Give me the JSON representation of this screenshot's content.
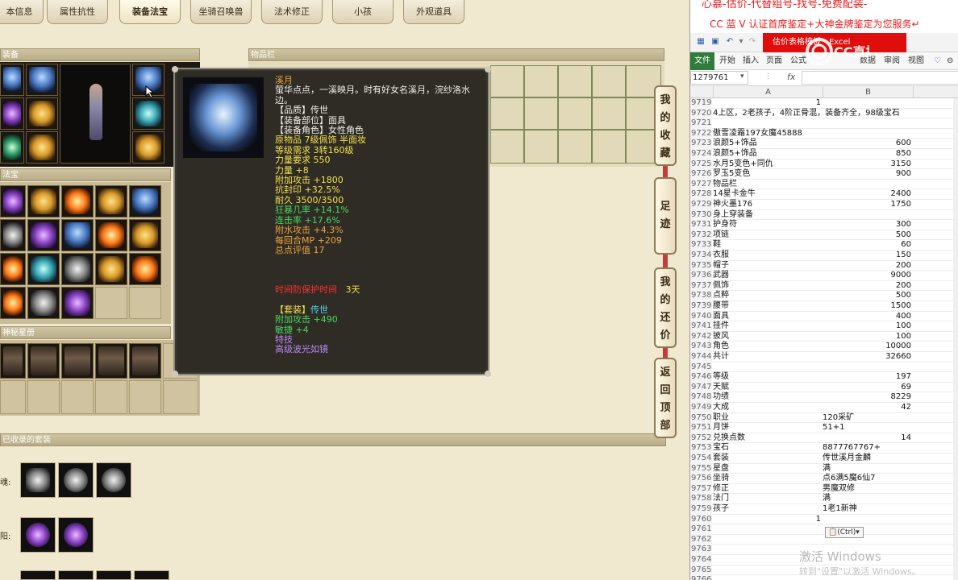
{
  "tabs": [
    "本信息",
    "属性抗性",
    "装备法宝",
    "坐骑召唤兽",
    "法术修正",
    "小孩",
    "外观道具"
  ],
  "active_tab": 2,
  "sections": {
    "equip": "装备",
    "inventory": "物品栏",
    "treasure": "法宝",
    "cards": "神秘星册",
    "suits": "已收录的套装"
  },
  "suit_labels": [
    "魂:",
    "阳:"
  ],
  "tooltip": {
    "name": "溪月",
    "desc": "萤华点点，一溪映月。时有好女名溪月，浣纱洛水边。",
    "quality": "【品质】传世",
    "slot": "【装备部位】面具",
    "role": "【装备角色】女性角色",
    "origin": "原物品 7级佩饰 半面妆",
    "level_req": "等级需求 3转160级",
    "str_req": "力量要求 550",
    "str": "力量 +8",
    "atk": "附加攻击 +1800",
    "seal_res": "抗封印 +32.5%",
    "durability": "耐久 3500/3500",
    "berserk": "狂暴几率 +14.1%",
    "combo": "连击率 +17.6%",
    "water_atk": "附水攻击 +4.3%",
    "mp_regen": "每回合MP +209",
    "score": "总点评值   17",
    "protect_label": "时间防保护时间",
    "protect_value": "3天",
    "suit_title": "【套装】",
    "suit_name": "传世",
    "suit_atk": "附加攻击 +490",
    "suit_agi": "敏捷 +4",
    "skill_label": "特技",
    "skill": "高级波光如镜"
  },
  "side_buttons": [
    {
      "label": "我的收藏",
      "chars": [
        "我",
        "的",
        "收",
        "藏"
      ]
    },
    {
      "label": "足迹",
      "chars": [
        "足",
        "迹"
      ]
    },
    {
      "label": "我的还价",
      "chars": [
        "我",
        "的",
        "还",
        "价"
      ]
    },
    {
      "label": "返回顶部",
      "chars": [
        "返",
        "回",
        "顶",
        "部"
      ]
    }
  ],
  "excel": {
    "banner_top": "心慕-估价-代替组号-找号-免费配装-",
    "banner_2": "CC 蓝 V 认证首席鉴定+大神金牌鉴定为您服务↵",
    "red_box": "估价表格模板 - Excel",
    "menu": [
      "文件",
      "开始",
      "插入",
      "页面",
      "公式",
      "数据",
      "审阅",
      "视图"
    ],
    "name_box": "1279761",
    "fx": "fx",
    "col_a": "A",
    "col_b": "B",
    "paste_tip": "(Ctrl)",
    "watermark_1": "激活 Windows",
    "watermark_2": "转到\"设置\"以激活 Windows。",
    "logo_text": "CC直播",
    "rows": [
      {
        "n": "9719",
        "a": "",
        "b": "",
        "an": "1"
      },
      {
        "n": "9720",
        "a": "4上区，2老孩子，4阶正骨混，装备齐全，98级宝石",
        "b": ""
      },
      {
        "n": "9721",
        "a": "",
        "b": ""
      },
      {
        "n": "9722",
        "a": "傲雪凌霜197女魔45888",
        "b": ""
      },
      {
        "n": "9723",
        "a": "浪颜5+饰品",
        "b": "600"
      },
      {
        "n": "9724",
        "a": "浪颜5+饰品",
        "b": "850"
      },
      {
        "n": "9725",
        "a": "水月5变色+同仇",
        "b": "3150"
      },
      {
        "n": "9726",
        "a": "罗玉5变色",
        "b": "900"
      },
      {
        "n": "9727",
        "a": "物品栏",
        "b": ""
      },
      {
        "n": "9728",
        "a": "14星卡金牛",
        "b": "2400"
      },
      {
        "n": "9729",
        "a": "神火墨176",
        "b": "1750"
      },
      {
        "n": "9730",
        "a": "身上穿装备",
        "b": ""
      },
      {
        "n": "9731",
        "a": "护身符",
        "b": "300"
      },
      {
        "n": "9732",
        "a": "项链",
        "b": "500"
      },
      {
        "n": "9733",
        "a": "鞋",
        "b": "60"
      },
      {
        "n": "9734",
        "a": "衣服",
        "b": "150"
      },
      {
        "n": "9735",
        "a": "帽子",
        "b": "200"
      },
      {
        "n": "9736",
        "a": "武器",
        "b": "9000"
      },
      {
        "n": "9737",
        "a": "佩饰",
        "b": "200"
      },
      {
        "n": "9738",
        "a": "点粹",
        "b": "500"
      },
      {
        "n": "9739",
        "a": "腰带",
        "b": "1500"
      },
      {
        "n": "9740",
        "a": "面具",
        "b": "400"
      },
      {
        "n": "9741",
        "a": "挂件",
        "b": "100"
      },
      {
        "n": "9742",
        "a": "披风",
        "b": "100"
      },
      {
        "n": "9743",
        "a": "角色",
        "b": "10000"
      },
      {
        "n": "9744",
        "a": "共计",
        "b": "32660"
      },
      {
        "n": "9745",
        "a": "",
        "b": ""
      },
      {
        "n": "9746",
        "a": "等级",
        "b": "197"
      },
      {
        "n": "9747",
        "a": "天赋",
        "b": "69"
      },
      {
        "n": "9748",
        "a": "功绩",
        "b": "8229"
      },
      {
        "n": "9749",
        "a": "大成",
        "b": "42"
      },
      {
        "n": "9750",
        "a": "职业",
        "b": "120采矿",
        "bt": true
      },
      {
        "n": "9751",
        "a": "月饼",
        "b": "51+1",
        "bt": true
      },
      {
        "n": "9752",
        "a": "兑换点数",
        "b": "14"
      },
      {
        "n": "9753",
        "a": "宝石",
        "b": "8877767767+",
        "bt": true
      },
      {
        "n": "9754",
        "a": "套装",
        "b": "传世溪月金麟",
        "bt": true
      },
      {
        "n": "9755",
        "a": "星盘",
        "b": "满",
        "bt": true
      },
      {
        "n": "9756",
        "a": "坐骑",
        "b": "点6满5魔6仙7",
        "bt": true
      },
      {
        "n": "9757",
        "a": "修正",
        "b": "男魔双修",
        "bt": true
      },
      {
        "n": "9758",
        "a": "法门",
        "b": "满",
        "bt": true
      },
      {
        "n": "9759",
        "a": "孩子",
        "b": "1老1新神",
        "bt": true
      },
      {
        "n": "9760",
        "a": "",
        "b": "",
        "an": "1"
      },
      {
        "n": "9761",
        "a": "",
        "b": ""
      },
      {
        "n": "9762",
        "a": "",
        "b": ""
      },
      {
        "n": "9763",
        "a": "",
        "b": ""
      },
      {
        "n": "9764",
        "a": "",
        "b": ""
      },
      {
        "n": "9765",
        "a": "",
        "b": ""
      },
      {
        "n": "9766",
        "a": "",
        "b": ""
      }
    ]
  }
}
